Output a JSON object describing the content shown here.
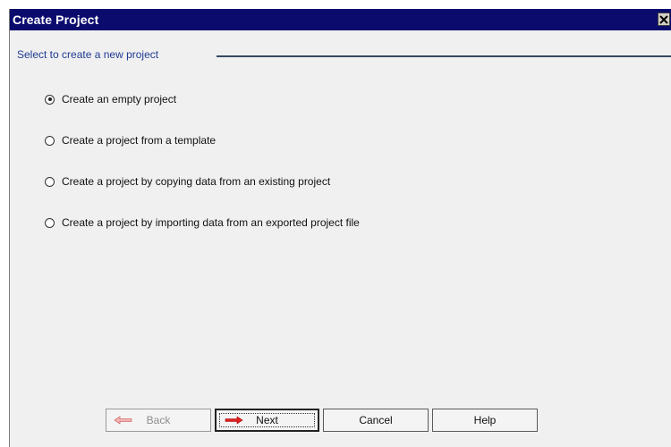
{
  "window": {
    "title": "Create Project"
  },
  "section": {
    "title": "Select to create a new project"
  },
  "options": [
    {
      "label": "Create an empty project",
      "selected": true
    },
    {
      "label": "Create a project from a template",
      "selected": false
    },
    {
      "label": "Create a project by copying data from an existing project",
      "selected": false
    },
    {
      "label": "Create a project by importing data from an exported project file",
      "selected": false
    }
  ],
  "buttons": {
    "back": {
      "label": "Back",
      "icon": "left-arrow-icon",
      "enabled": false
    },
    "next": {
      "label": "Next",
      "icon": "right-arrow-icon",
      "enabled": true
    },
    "cancel": {
      "label": "Cancel"
    },
    "help": {
      "label": "Help"
    }
  },
  "colors": {
    "titlebar": "#0b0b6e",
    "section_title": "#1f3a93",
    "arrow_red": "#e02020"
  }
}
